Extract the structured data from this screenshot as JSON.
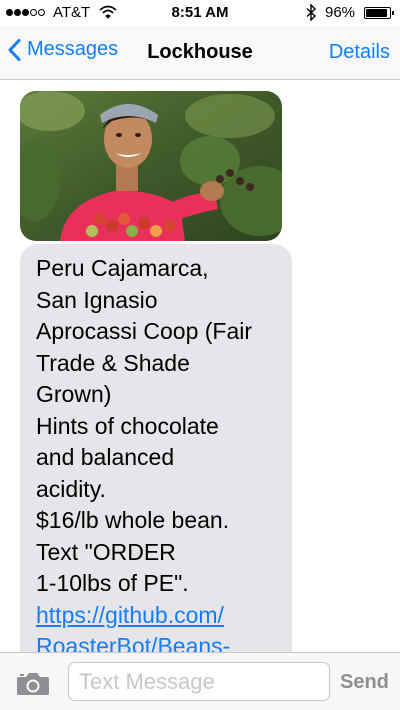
{
  "status_bar": {
    "signal_bars_filled": 3,
    "signal_bars_total": 5,
    "carrier": "AT&T",
    "time": "8:51 AM",
    "battery_percent": "96%",
    "battery_level": 0.96
  },
  "nav": {
    "back_label": "Messages",
    "title": "Lockhouse",
    "details_label": "Details"
  },
  "conversation": {
    "photo_icon": "coffee-farmer-photo",
    "message_lines": [
      "Peru Cajamarca,",
      "San Ignasio",
      "Aprocassi Coop (Fair",
      "Trade & Shade",
      "Grown)",
      "Hints of chocolate",
      "and balanced",
      "acidity.",
      "$16/lb whole bean.",
      "Text \"ORDER",
      "1-10lbs of PE\"."
    ],
    "link_lines": [
      "https://github.com/",
      "RoasterBot/Beans-"
    ]
  },
  "input_bar": {
    "camera_icon": "camera-icon",
    "placeholder": "Text Message",
    "send_label": "Send"
  },
  "colors": {
    "accent": "#147efb",
    "bubble_received": "#e5e5ea",
    "send_disabled": "#8e8e93"
  }
}
